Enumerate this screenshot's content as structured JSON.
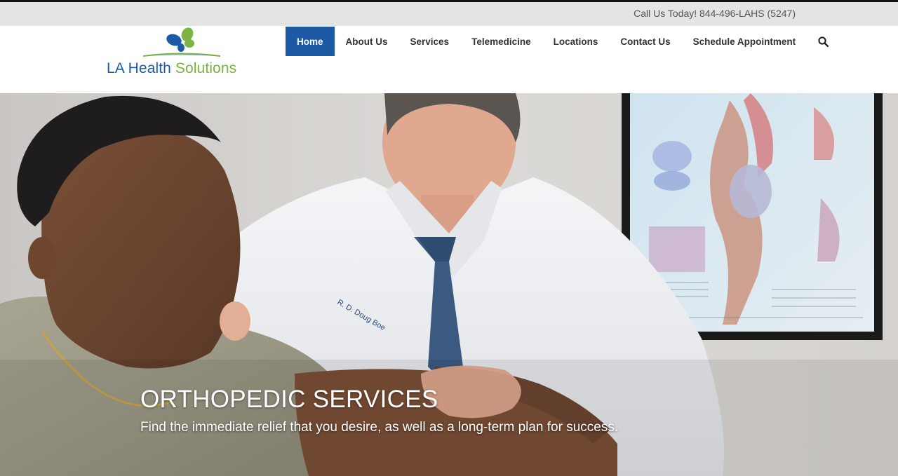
{
  "topbar": {
    "phone": "Call Us Today! 844-496-LAHS (5247)"
  },
  "logo": {
    "part1": "LA Health",
    "part2": " Solutions",
    "icon": "butterfly-logo-icon"
  },
  "nav": {
    "items": [
      {
        "label": "Home",
        "active": true
      },
      {
        "label": "About Us"
      },
      {
        "label": "Services"
      },
      {
        "label": "Telemedicine"
      },
      {
        "label": "Locations"
      },
      {
        "label": "Contact Us"
      },
      {
        "label": "Schedule Appointment"
      }
    ],
    "search_icon": "search-icon"
  },
  "hero": {
    "title": "ORTHOPEDIC SERVICES",
    "subtitle": "Find the immediate relief that you desire, as well as a long-term plan for success.",
    "image": "doctor-examining-patient-arm-photo"
  },
  "colors": {
    "brand_blue": "#1d5aa6",
    "brand_green": "#7cb342",
    "topbar_bg": "#e4e4e4"
  }
}
